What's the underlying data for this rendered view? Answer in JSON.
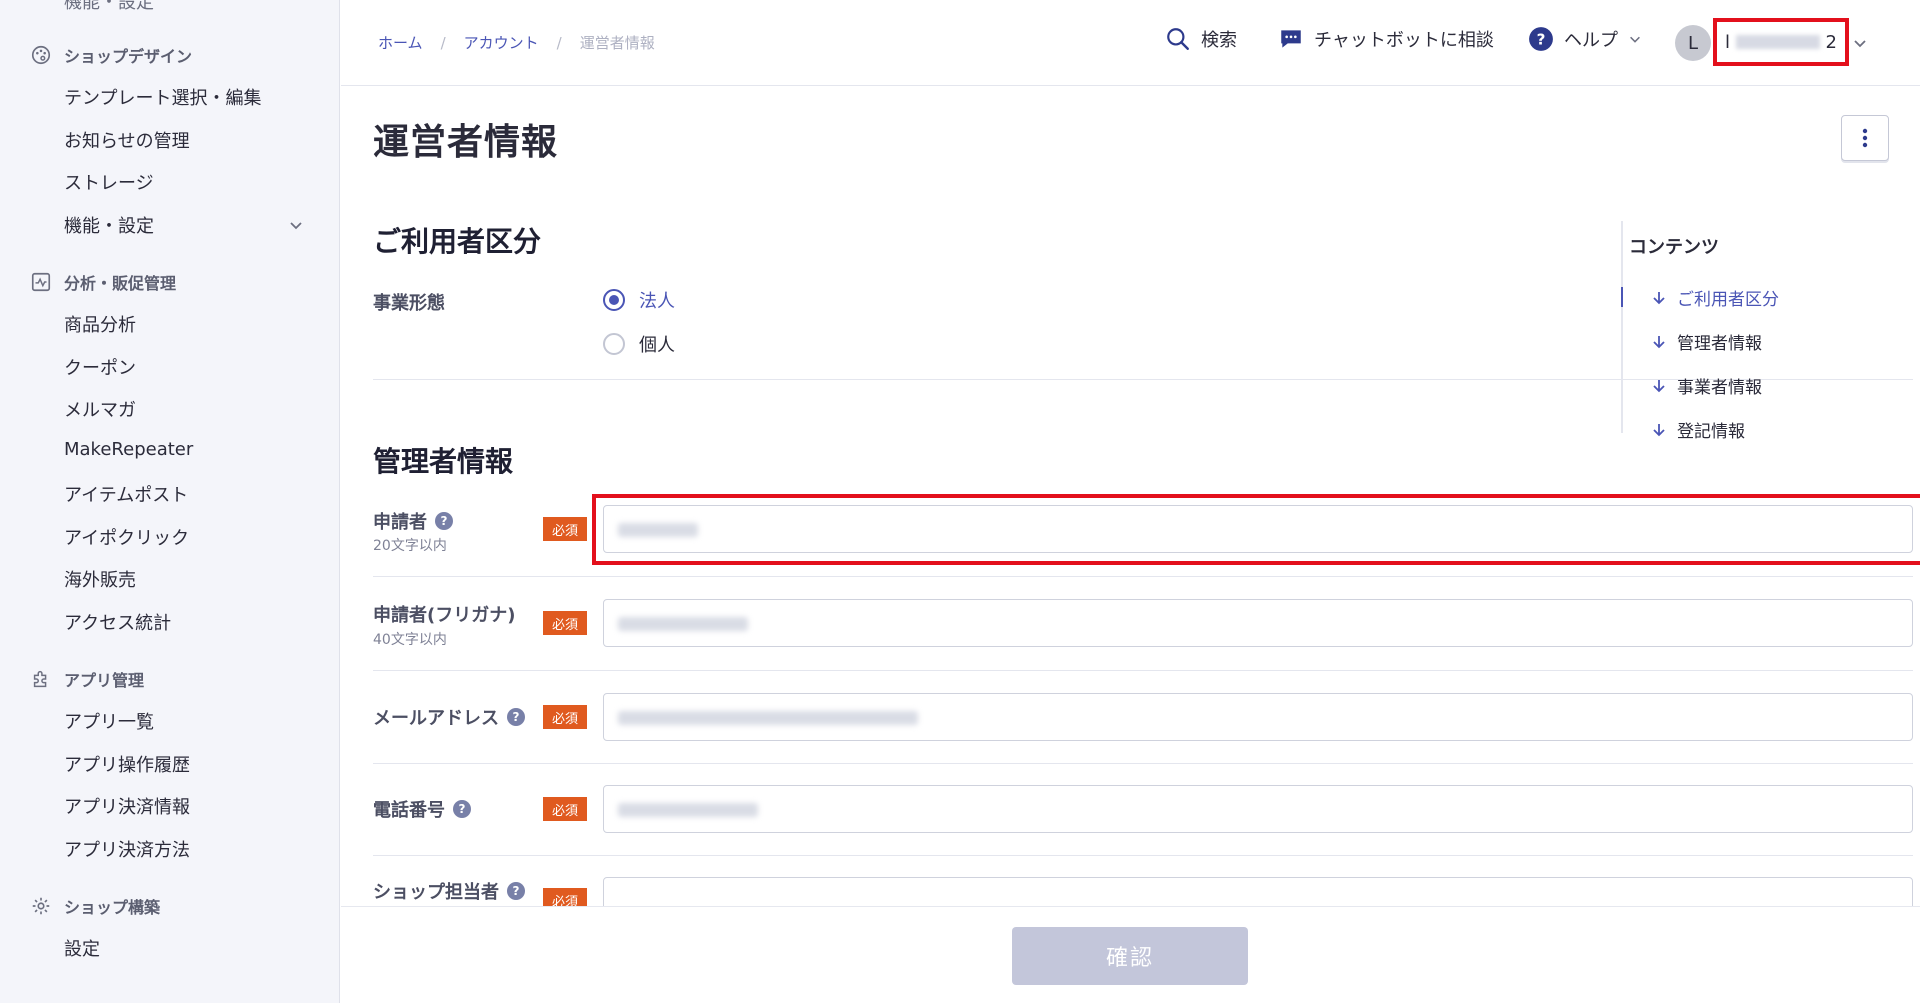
{
  "sidebar": {
    "top_cut_label": "機能・設定",
    "shop_design": {
      "title": "ショップデザイン",
      "items": [
        "テンプレート選択・編集",
        "お知らせの管理",
        "ストレージ",
        "機能・設定"
      ]
    },
    "analytics": {
      "title": "分析・販促管理",
      "items": [
        "商品分析",
        "クーポン",
        "メルマガ",
        "MakeRepeater",
        "アイテムポスト",
        "アイポクリック",
        "海外販売",
        "アクセス統計"
      ]
    },
    "apps": {
      "title": "アプリ管理",
      "items": [
        "アプリ一覧",
        "アプリ操作履歴",
        "アプリ決済情報",
        "アプリ決済方法"
      ]
    },
    "shop_build": {
      "title": "ショップ構築",
      "items": [
        "設定"
      ]
    }
  },
  "header": {
    "breadcrumbs": [
      "ホーム",
      "アカウント",
      "運営者情報"
    ],
    "separator": "/",
    "search_label": "検索",
    "chatbot_label": "チャットボットに相談",
    "help_label": "ヘルプ",
    "avatar_initial": "L",
    "user_prefix": "l",
    "user_suffix": "2"
  },
  "page": {
    "title": "運営者情報"
  },
  "user_type_section": {
    "title": "ご利用者区分",
    "business_type_label": "事業形態",
    "options": [
      {
        "label": "法人",
        "selected": true
      },
      {
        "label": "個人",
        "selected": false
      }
    ]
  },
  "admin_section": {
    "title": "管理者情報",
    "required_badge": "必須",
    "help_symbol": "?",
    "fields": [
      {
        "label": "申請者",
        "hint": "20文字以内",
        "has_help": true
      },
      {
        "label": "申請者(フリガナ)",
        "hint": "40文字以内",
        "has_help": false
      },
      {
        "label": "メールアドレス",
        "hint": "",
        "has_help": true
      },
      {
        "label": "電話番号",
        "hint": "",
        "has_help": true
      },
      {
        "label": "ショップ担当者",
        "hint": "",
        "has_help": true
      }
    ]
  },
  "toc": {
    "title": "コンテンツ",
    "items": [
      {
        "label": "ご利用者区分",
        "active": true
      },
      {
        "label": "管理者情報",
        "active": false
      },
      {
        "label": "事業者情報",
        "active": false
      },
      {
        "label": "登記情報",
        "active": false
      }
    ]
  },
  "footer": {
    "confirm_label": "確認"
  },
  "colors": {
    "accent": "#4a55b5",
    "required": "#e05a1f",
    "highlight": "#e3101c",
    "disabled_button": "#c3c6da"
  }
}
